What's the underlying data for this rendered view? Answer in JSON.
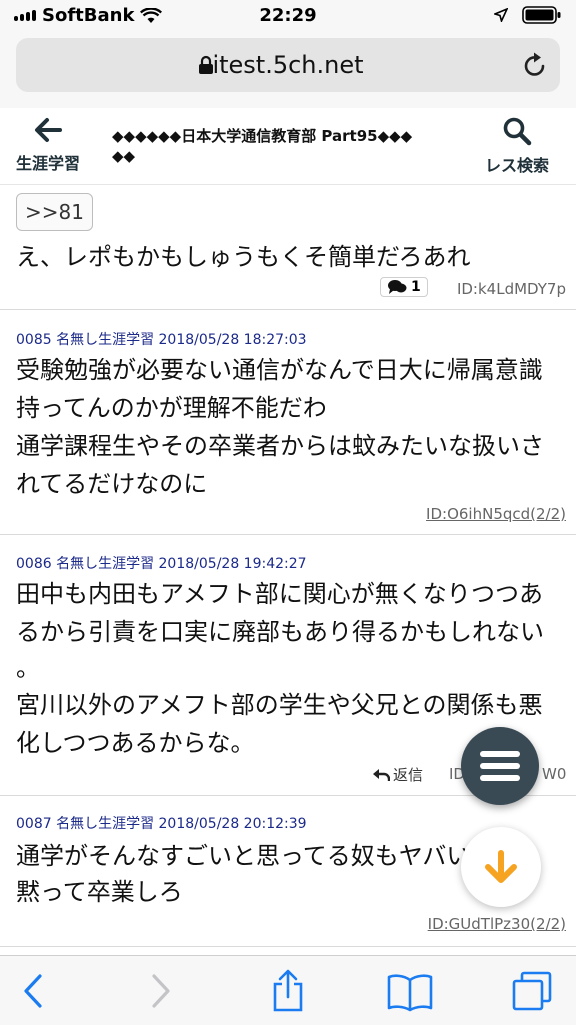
{
  "status_bar": {
    "carrier": "SoftBank",
    "time": "22:29"
  },
  "browser": {
    "domain": "itest.5ch.net"
  },
  "thread_header": {
    "back_label": "生涯学習",
    "title": "◆◆◆◆◆◆日本大学通信教育部 Part95◆◆◆",
    "title_line2": "◆◆",
    "search_label": "レス検索"
  },
  "posts": [
    {
      "anchor": ">>81",
      "lines": [
        "え、レポもかもしゅうもくそ簡単だろあれ"
      ],
      "reply_count": "1",
      "id": "ID:k4LdMDY7p"
    },
    {
      "meta": "0085 名無し生涯学習 2018/05/28 18:27:03",
      "lines": [
        "受験勉強が必要ない通信がなんで日大に帰属意識",
        "持ってんのかが理解不能だわ",
        "通学課程生やその卒業者からは蚊みたいな扱いさ",
        "れてるだけなのに"
      ],
      "id": "ID:O6ihN5qcd(2/2)"
    },
    {
      "meta": "0086 名無し生涯学習 2018/05/28 19:42:27",
      "lines": [
        "田中も内田もアメフト部に関心が無くなりつつあ",
        "るから引責を口実に廃部もあり得るかもしれない",
        "。",
        "宮川以外のアメフト部の学生や父兄との関係も悪",
        "化しつつあるからな。"
      ],
      "reply_label": "返信",
      "id_left": "ID",
      "id_right": "W0"
    },
    {
      "meta": "0087 名無し生涯学習 2018/05/28 20:12:39",
      "lines": [
        "通学がそんなすごいと思ってる奴もヤバい",
        "黙って卒業しろ"
      ],
      "id": "ID:GUdTlPz30(2/2)"
    }
  ],
  "colors": {
    "accent": "#1a7cf0",
    "fab": "#3a4a54",
    "down_arrow": "#f5a320",
    "meta": "#1c2a8a"
  }
}
